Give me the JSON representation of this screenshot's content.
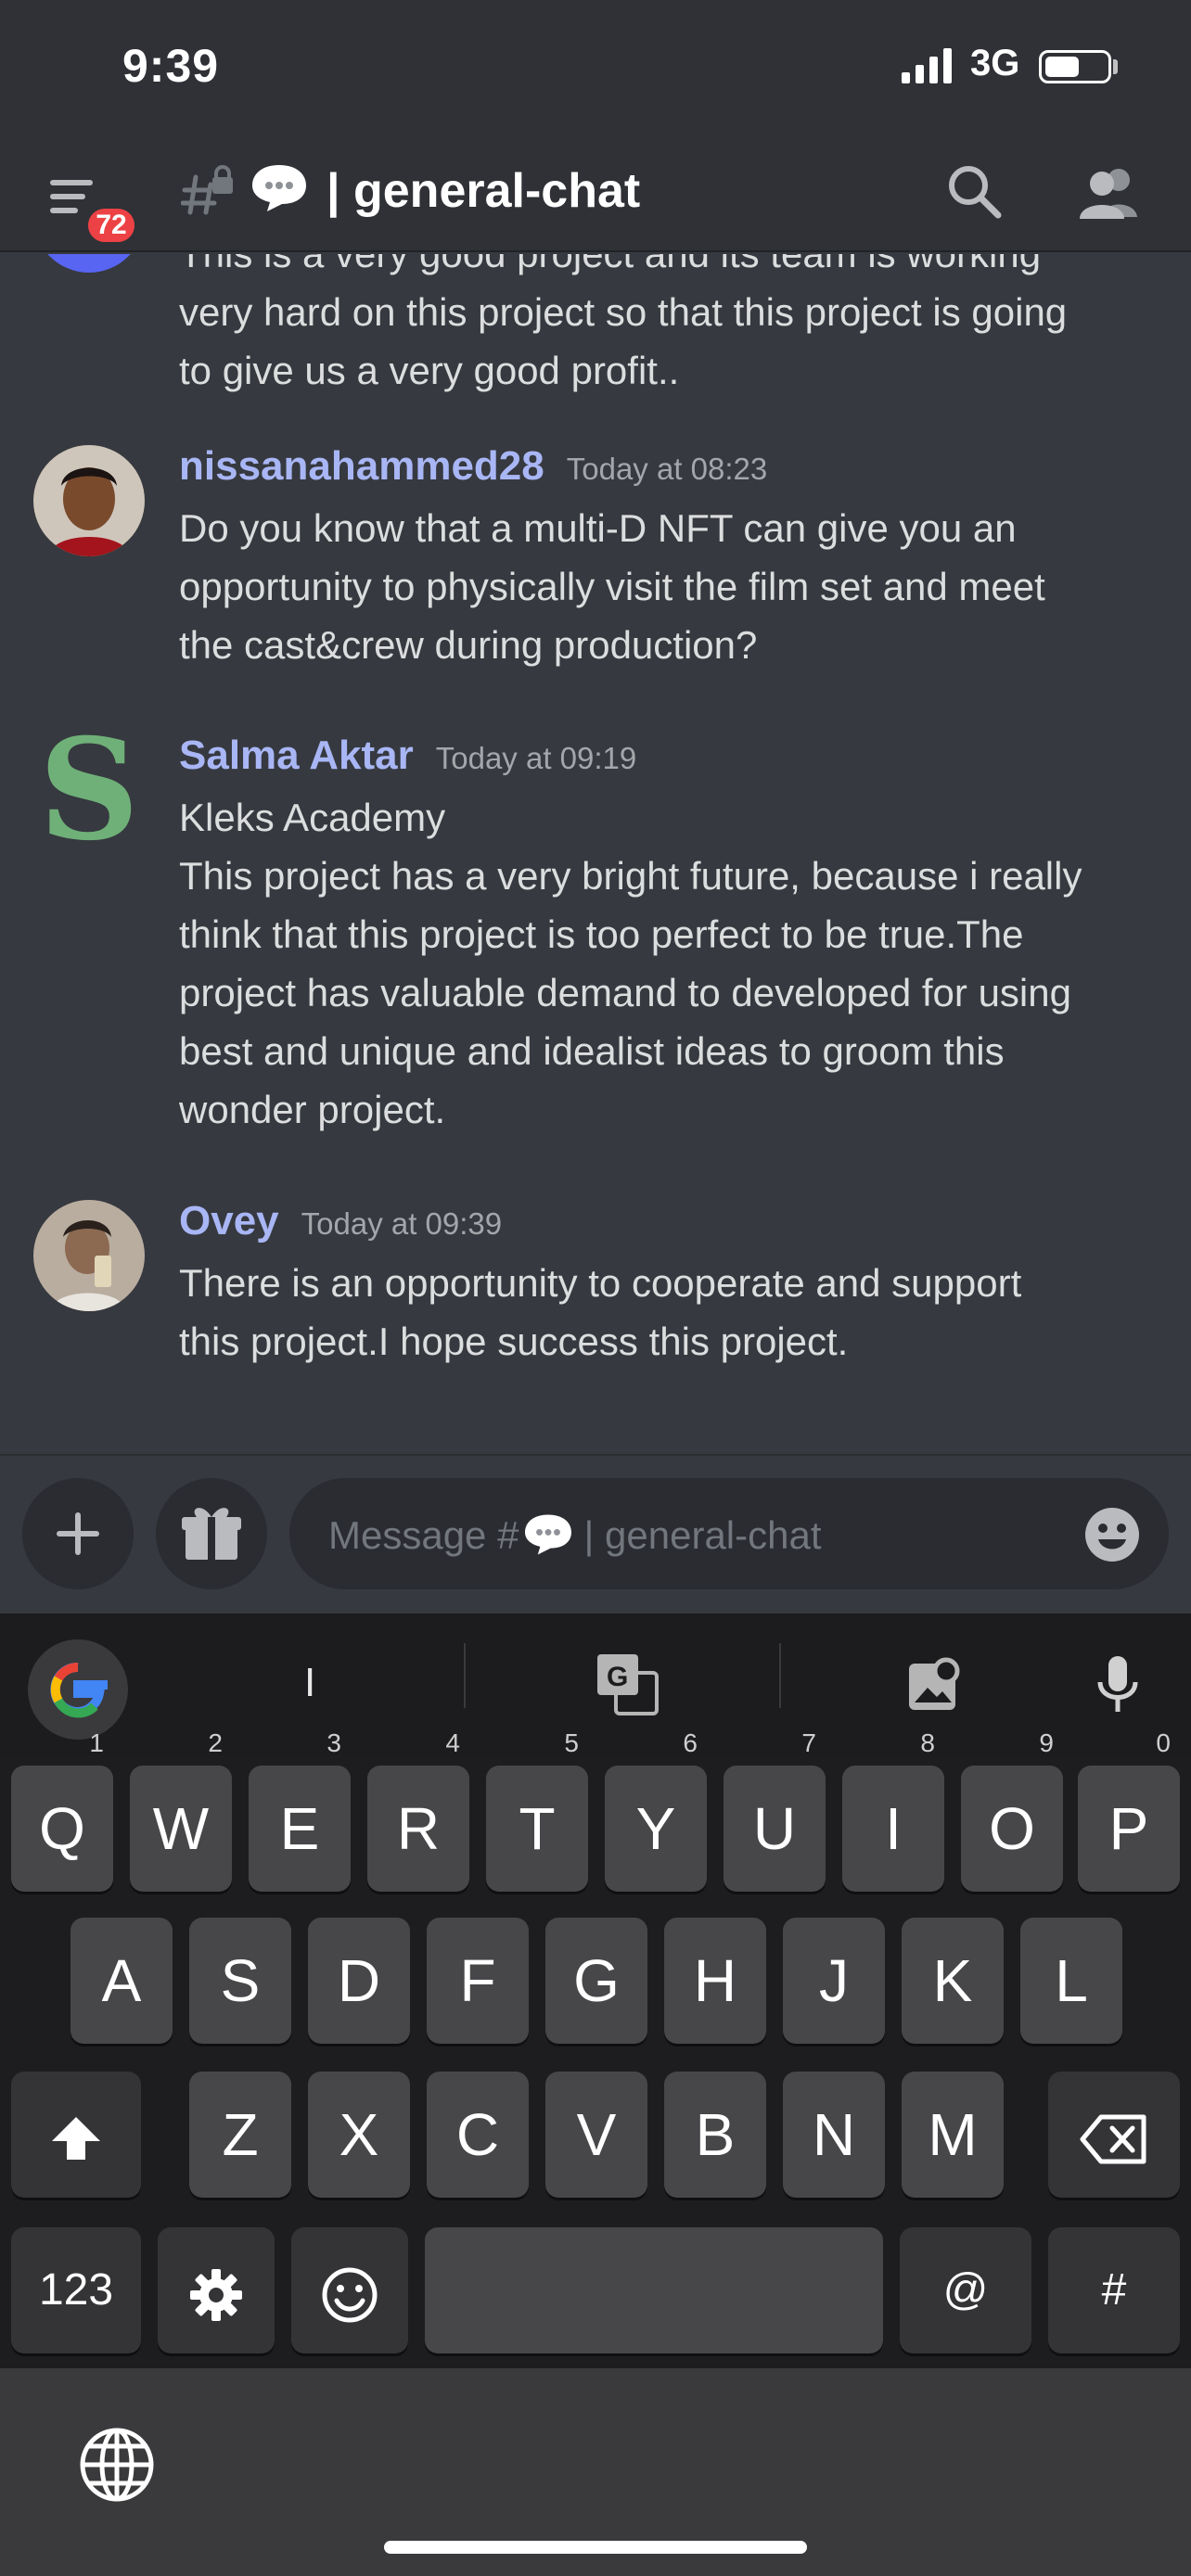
{
  "status_bar": {
    "time": "9:39",
    "network": "3G"
  },
  "header": {
    "badge_count": "72",
    "channel_name": "| general-chat"
  },
  "messages": [
    {
      "author": "",
      "time": "",
      "text": "This is a very good project and its team is working\nvery hard on this project so that this project is going\nto give us a very good profit.."
    },
    {
      "author": "nissanahammed28",
      "time": "Today at 08:23",
      "text": "Do you know that a multi-D NFT can give you an\nopportunity to physically visit the film set and meet\nthe cast&crew during production?"
    },
    {
      "author": "Salma Aktar",
      "time": "Today at 09:19",
      "avatar_letter": "S",
      "text": "Kleks Academy\nThis project has a very bright future, because i really\nthink that this project is too perfect to be true.The\nproject has valuable demand to developed for using\nbest and unique and idealist ideas to groom this\nwonder project."
    },
    {
      "author": "Ovey",
      "time": "Today at 09:39",
      "text": "There is an opportunity to cooperate and support\nthis project.I hope success this project."
    }
  ],
  "composer": {
    "placeholder_prefix": "Message #",
    "placeholder_suffix": "| general-chat"
  },
  "keyboard": {
    "suggestion": "I",
    "row1": [
      "Q",
      "W",
      "E",
      "R",
      "T",
      "Y",
      "U",
      "I",
      "O",
      "P"
    ],
    "row1_hints": [
      "1",
      "2",
      "3",
      "4",
      "5",
      "6",
      "7",
      "8",
      "9",
      "0"
    ],
    "row2": [
      "A",
      "S",
      "D",
      "F",
      "G",
      "H",
      "J",
      "K",
      "L"
    ],
    "row3": [
      "Z",
      "X",
      "C",
      "V",
      "B",
      "N",
      "M"
    ],
    "numbers_key": "123",
    "at_key": "@",
    "hash_key": "#"
  },
  "colors": {
    "background": "#36393f",
    "header": "#2f3136",
    "author": "#a9b6f5",
    "badge": "#ed4245",
    "keyboard": "#1d1d1f"
  },
  "icons": [
    "menu-icon",
    "locked-hash-icon",
    "speech-bubble-icon",
    "search-icon",
    "members-icon",
    "plus-icon",
    "gift-icon",
    "emoji-icon",
    "google-icon",
    "translate-icon",
    "image-search-icon",
    "microphone-icon",
    "shift-icon",
    "backspace-icon",
    "settings-icon",
    "smiley-icon",
    "globe-icon"
  ]
}
